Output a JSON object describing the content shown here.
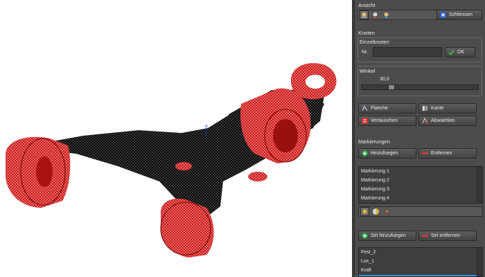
{
  "panel": {
    "ansicht": {
      "title": "Ansicht",
      "close_label": "Schliessen"
    },
    "knoten": {
      "title": "Knoten",
      "einzelknoten": {
        "title": "Einzelknoten",
        "nr_label": "Nr.",
        "nr_value": "",
        "ok_label": "OK"
      },
      "winkel": {
        "title": "Winkel",
        "value": "30,0",
        "slider_fraction": 0.24
      },
      "buttons": {
        "flaeche": "Flaeche",
        "kante": "Kante",
        "vertauschen": "Vertauschen",
        "abwaehlen": "Abwaehlen"
      }
    },
    "markierungen": {
      "title": "Markierungen",
      "add_label": "Hinzufuegen",
      "remove_label": "Entfernen",
      "items": [
        "Markierung 1",
        "Markierung 2",
        "Markierung 3",
        "Markierung 4"
      ]
    },
    "sets": {
      "add_label": "Set hinzufuegen",
      "remove_label": "Set entfernen",
      "items": [
        "Fest_2",
        "Los_1",
        "Kraft",
        ""
      ],
      "selected_index": 3
    }
  },
  "viewport": {
    "axis_label": "Z"
  },
  "colors": {
    "mesh_red": "#d01818",
    "mesh_black": "#0a0a0a",
    "panel_bg": "#4c4c4c",
    "add_green": "#2faa4a",
    "remove_red": "#d63a3a",
    "selection_blue": "#3a8fd8"
  }
}
